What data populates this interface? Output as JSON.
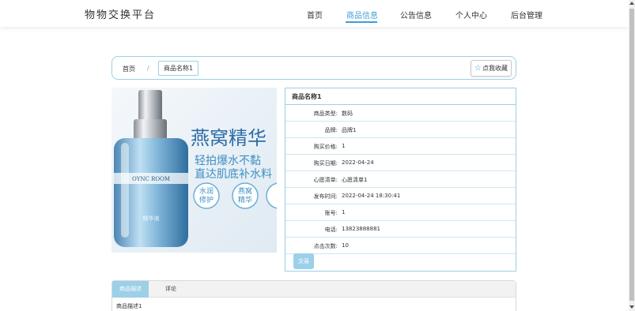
{
  "brand": "物物交换平台",
  "nav": {
    "items": [
      {
        "label": "首页",
        "active": false
      },
      {
        "label": "商品信息",
        "active": true
      },
      {
        "label": "公告信息",
        "active": false
      },
      {
        "label": "个人中心",
        "active": false
      },
      {
        "label": "后台管理",
        "active": false
      }
    ]
  },
  "breadcrumb": {
    "home": "首页",
    "separator": "/",
    "current": "商品名称1"
  },
  "favorite_button": "点我收藏",
  "product_image": {
    "headline": "燕窝精华",
    "line1": "轻拍爆水不黏",
    "line2": "直达肌底补水料",
    "badge1_line1": "水润",
    "badge1_line2": "修护",
    "badge2_line1": "燕窝",
    "badge2_line2": "精华",
    "bottle_brand": "OYNC ROOM",
    "bottle_label": "精华液"
  },
  "info": {
    "title": "商品名称1",
    "rows": [
      {
        "label": "商品类型:",
        "value": "数码"
      },
      {
        "label": "品牌:",
        "value": "品牌1"
      },
      {
        "label": "购买价格:",
        "value": "1"
      },
      {
        "label": "购买日期:",
        "value": "2022-04-24"
      },
      {
        "label": "心愿清单:",
        "value": "心愿清单1"
      },
      {
        "label": "发布时间:",
        "value": "2022-04-24 18:30:41"
      },
      {
        "label": "账号:",
        "value": "1"
      },
      {
        "label": "电话:",
        "value": "13823888881"
      },
      {
        "label": "点击次数:",
        "value": "10"
      }
    ],
    "trade_button": "交易"
  },
  "tabs": {
    "items": [
      "商品描述",
      "评论"
    ],
    "content": "商品描述1"
  },
  "colors": {
    "accent": "#3c9fd6",
    "light_accent": "#9ccfe8"
  }
}
